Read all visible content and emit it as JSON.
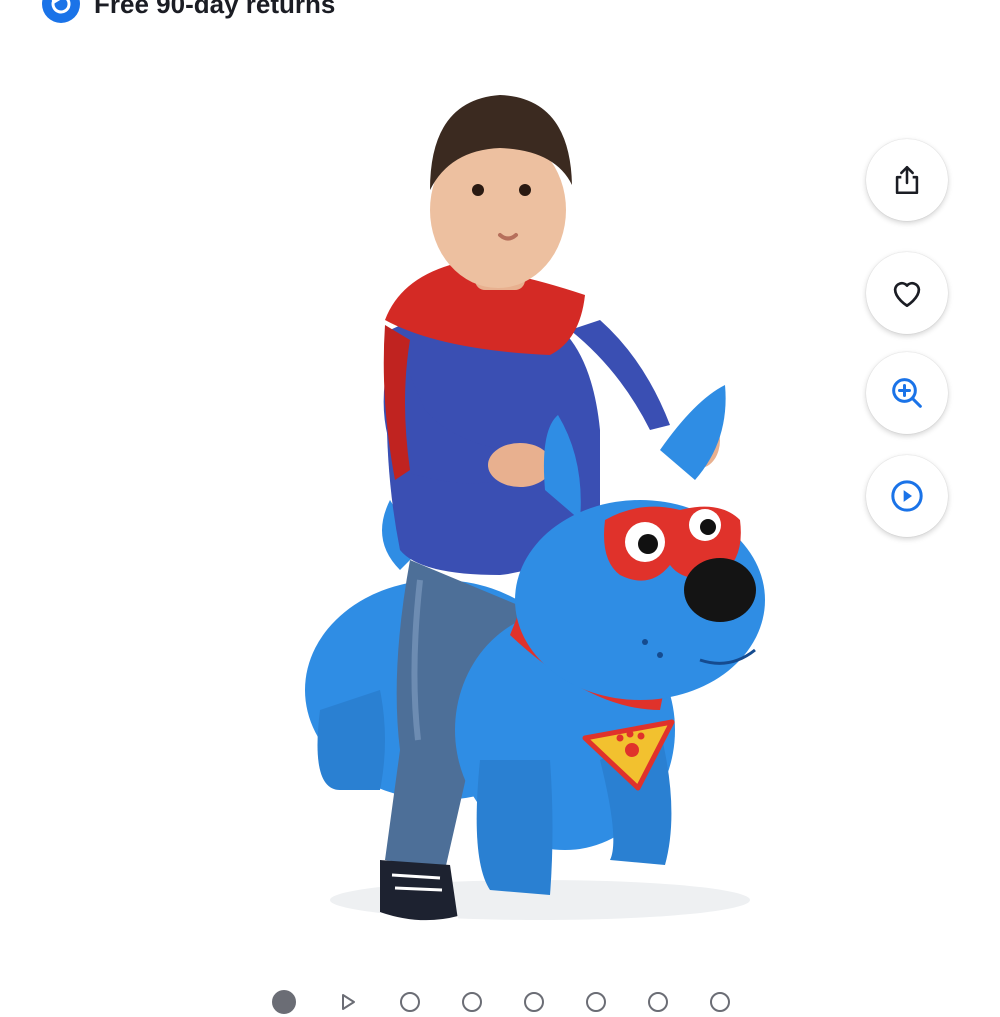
{
  "returns": {
    "label": "Free 90-day returns"
  },
  "product": {
    "image_description_icon": "toy-image"
  },
  "actions": [
    {
      "name": "share-button",
      "icon": "share-icon"
    },
    {
      "name": "favorite-button",
      "icon": "heart-icon"
    },
    {
      "name": "zoom-button",
      "icon": "zoom-in-icon"
    },
    {
      "name": "play-video-button",
      "icon": "play-icon"
    }
  ],
  "carousel": {
    "total": 8,
    "active_index": 0,
    "video_index": 1
  },
  "colors": {
    "accent": "#1a73e8",
    "toy": "#2f8de4",
    "text": "#1b1d24"
  }
}
